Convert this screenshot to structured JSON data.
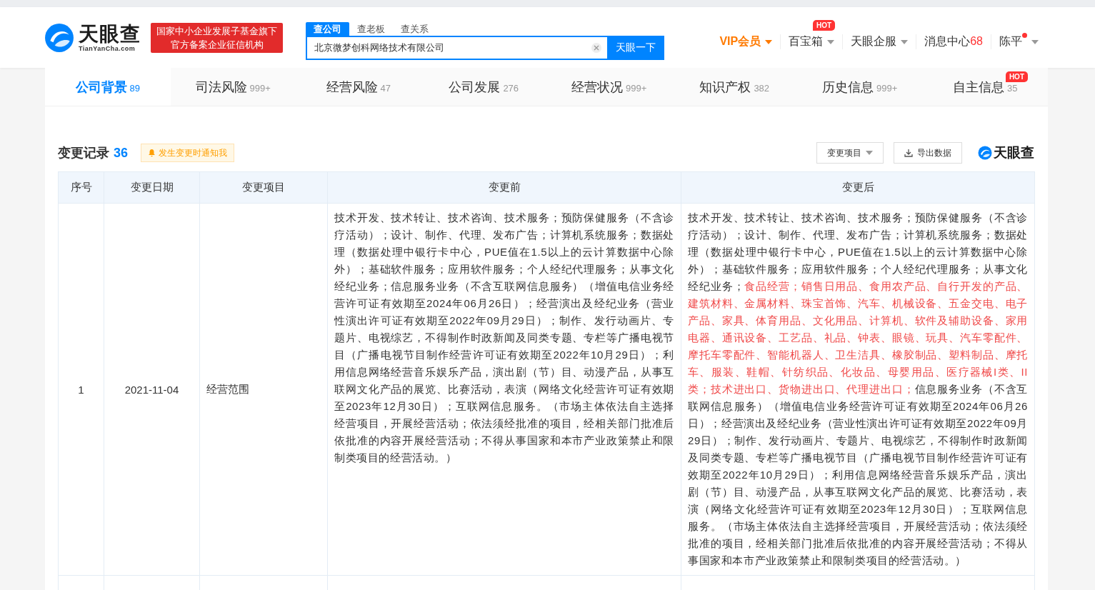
{
  "header": {
    "logo": {
      "name": "天眼查",
      "domain": "TianYanCha.com"
    },
    "badge": [
      "国家中小企业发展子基金旗下",
      "官方备案企业征信机构"
    ],
    "search": {
      "tabs": [
        {
          "label": "查公司",
          "selected": true
        },
        {
          "label": "查老板",
          "selected": false
        },
        {
          "label": "查关系",
          "selected": false
        }
      ],
      "value": "北京微梦创科网络技术有限公司",
      "button": "天眼一下"
    },
    "nav": [
      {
        "label": "VIP会员",
        "kind": "vip"
      },
      {
        "label": "百宝箱",
        "kind": "menu",
        "hot_badge": "HOT"
      },
      {
        "label": "天眼企服",
        "kind": "menu"
      },
      {
        "label": "消息中心",
        "kind": "count",
        "count": "68"
      },
      {
        "label": "陈平",
        "kind": "user"
      }
    ]
  },
  "tabs": [
    {
      "label": "公司背景",
      "count": "89",
      "selected": true
    },
    {
      "label": "司法风险",
      "count": "999+",
      "selected": false
    },
    {
      "label": "经营风险",
      "count": "47",
      "selected": false
    },
    {
      "label": "公司发展",
      "count": "276",
      "selected": false
    },
    {
      "label": "经营状况",
      "count": "999+",
      "selected": false
    },
    {
      "label": "知识产权",
      "count": "382",
      "selected": false
    },
    {
      "label": "历史信息",
      "count": "999+",
      "selected": false
    },
    {
      "label": "自主信息",
      "count": "35",
      "selected": false,
      "hot_badge": "HOT"
    }
  ],
  "section": {
    "title": "变更记录",
    "count": "36",
    "notify": "发生变更时通知我",
    "filter": "变更项目",
    "export": "导出数据",
    "brand": "天眼查"
  },
  "table": {
    "columns": [
      "序号",
      "变更日期",
      "变更项目",
      "变更前",
      "变更后"
    ],
    "rows": [
      {
        "index": "1",
        "date": "2021-11-04",
        "item": "经营范围",
        "before": "技术开发、技术转让、技术咨询、技术服务；预防保健服务（不含诊疗活动）；设计、制作、代理、发布广告；计算机系统服务；数据处理（数据处理中银行卡中心，PUE值在1.5以上的云计算数据中心除外）；基础软件服务；应用软件服务；个人经纪代理服务；从事文化经纪业务；信息服务业务（不含互联网信息服务）（增值电信业务经营许可证有效期至2024年06月26日）；经营演出及经纪业务（营业性演出许可证有效期至2022年09月29日）；制作、发行动画片、专题片、电视综艺，不得制作时政新闻及同类专题、专栏等广播电视节目（广播电视节目制作经营许可证有效期至2022年10月29日）；利用信息网络经营音乐娱乐产品，演出剧（节）目、动漫产品，从事互联网文化产品的展览、比赛活动，表演（网络文化经营许可证有效期至2023年12月30日）；互联网信息服务。（市场主体依法自主选择经营项目，开展经营活动；依法须经批准的项目，经相关部门批准后依批准的内容开展经营活动；不得从事国家和本市产业政策禁止和限制类项目的经营活动。）",
        "after": [
          {
            "text": "技术开发、技术转让、技术咨询、技术服务；预防保健服务（不含诊疗活动）；设计、制作、代理、发布广告；计算机系统服务；数据处理（数据处理中银行卡中心，PUE值在1.5以上的云计算数据中心除外）；基础软件服务；应用软件服务；个人经纪代理服务；从事文化经纪业务；",
            "changed": false
          },
          {
            "text": "食品经营；销售日用品、食用农产品、自行开发的产品、建筑材料、金属材料、珠宝首饰、汽车、机械设备、五金交电、电子产品、家具、体育用品、文化用品、计算机、软件及辅助设备、家用电器、通讯设备、工艺品、礼品、钟表、眼镜、玩具、汽车零配件、摩托车零配件、智能机器人、卫生洁具、橡胶制品、塑料制品、摩托车、服装、鞋帽、针纺织品、化妆品、母婴用品、医疗器械I类、II类；技术进出口、货物进出口、代理进出口；",
            "changed": true
          },
          {
            "text": "信息服务业务（不含互联网信息服务）（增值电信业务经营许可证有效期至2024年06月26日）；经营演出及经纪业务（营业性演出许可证有效期至2022年09月29日）；制作、发行动画片、专题片、电视综艺，不得制作时政新闻及同类专题、专栏等广播电视节目（广播电视节目制作经营许可证有效期至2022年10月29日）；利用信息网络经营音乐娱乐产品，演出剧（节）目、动漫产品，从事互联网文化产品的展览、比赛活动，表演（网络文化经营许可证有效期至2023年12月30日）；互联网信息服务。（市场主体依法自主选择经营项目，开展经营活动；依法须经批准的项目，经相关部门批准后依批准的内容开展经营活动；不得从事国家和本市产业政策禁止和限制类项目的经营活动。）",
            "changed": false
          }
        ]
      }
    ]
  }
}
